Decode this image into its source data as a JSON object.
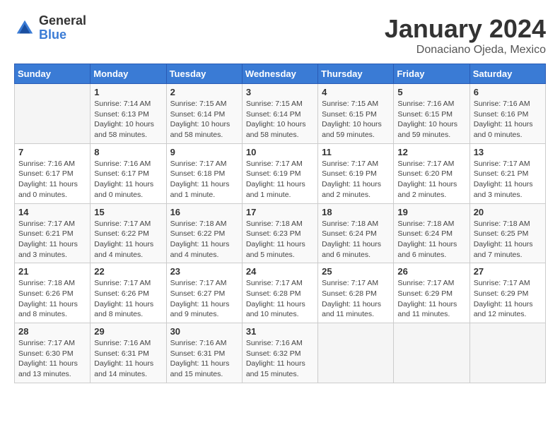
{
  "logo": {
    "general": "General",
    "blue": "Blue"
  },
  "title": {
    "month": "January 2024",
    "location": "Donaciano Ojeda, Mexico"
  },
  "weekdays": [
    "Sunday",
    "Monday",
    "Tuesday",
    "Wednesday",
    "Thursday",
    "Friday",
    "Saturday"
  ],
  "weeks": [
    [
      {
        "day": "",
        "info": ""
      },
      {
        "day": "1",
        "info": "Sunrise: 7:14 AM\nSunset: 6:13 PM\nDaylight: 10 hours\nand 58 minutes."
      },
      {
        "day": "2",
        "info": "Sunrise: 7:15 AM\nSunset: 6:14 PM\nDaylight: 10 hours\nand 58 minutes."
      },
      {
        "day": "3",
        "info": "Sunrise: 7:15 AM\nSunset: 6:14 PM\nDaylight: 10 hours\nand 58 minutes."
      },
      {
        "day": "4",
        "info": "Sunrise: 7:15 AM\nSunset: 6:15 PM\nDaylight: 10 hours\nand 59 minutes."
      },
      {
        "day": "5",
        "info": "Sunrise: 7:16 AM\nSunset: 6:15 PM\nDaylight: 10 hours\nand 59 minutes."
      },
      {
        "day": "6",
        "info": "Sunrise: 7:16 AM\nSunset: 6:16 PM\nDaylight: 11 hours\nand 0 minutes."
      }
    ],
    [
      {
        "day": "7",
        "info": "Sunrise: 7:16 AM\nSunset: 6:17 PM\nDaylight: 11 hours\nand 0 minutes."
      },
      {
        "day": "8",
        "info": "Sunrise: 7:16 AM\nSunset: 6:17 PM\nDaylight: 11 hours\nand 0 minutes."
      },
      {
        "day": "9",
        "info": "Sunrise: 7:17 AM\nSunset: 6:18 PM\nDaylight: 11 hours\nand 1 minute."
      },
      {
        "day": "10",
        "info": "Sunrise: 7:17 AM\nSunset: 6:19 PM\nDaylight: 11 hours\nand 1 minute."
      },
      {
        "day": "11",
        "info": "Sunrise: 7:17 AM\nSunset: 6:19 PM\nDaylight: 11 hours\nand 2 minutes."
      },
      {
        "day": "12",
        "info": "Sunrise: 7:17 AM\nSunset: 6:20 PM\nDaylight: 11 hours\nand 2 minutes."
      },
      {
        "day": "13",
        "info": "Sunrise: 7:17 AM\nSunset: 6:21 PM\nDaylight: 11 hours\nand 3 minutes."
      }
    ],
    [
      {
        "day": "14",
        "info": "Sunrise: 7:17 AM\nSunset: 6:21 PM\nDaylight: 11 hours\nand 3 minutes."
      },
      {
        "day": "15",
        "info": "Sunrise: 7:17 AM\nSunset: 6:22 PM\nDaylight: 11 hours\nand 4 minutes."
      },
      {
        "day": "16",
        "info": "Sunrise: 7:18 AM\nSunset: 6:22 PM\nDaylight: 11 hours\nand 4 minutes."
      },
      {
        "day": "17",
        "info": "Sunrise: 7:18 AM\nSunset: 6:23 PM\nDaylight: 11 hours\nand 5 minutes."
      },
      {
        "day": "18",
        "info": "Sunrise: 7:18 AM\nSunset: 6:24 PM\nDaylight: 11 hours\nand 6 minutes."
      },
      {
        "day": "19",
        "info": "Sunrise: 7:18 AM\nSunset: 6:24 PM\nDaylight: 11 hours\nand 6 minutes."
      },
      {
        "day": "20",
        "info": "Sunrise: 7:18 AM\nSunset: 6:25 PM\nDaylight: 11 hours\nand 7 minutes."
      }
    ],
    [
      {
        "day": "21",
        "info": "Sunrise: 7:18 AM\nSunset: 6:26 PM\nDaylight: 11 hours\nand 8 minutes."
      },
      {
        "day": "22",
        "info": "Sunrise: 7:17 AM\nSunset: 6:26 PM\nDaylight: 11 hours\nand 8 minutes."
      },
      {
        "day": "23",
        "info": "Sunrise: 7:17 AM\nSunset: 6:27 PM\nDaylight: 11 hours\nand 9 minutes."
      },
      {
        "day": "24",
        "info": "Sunrise: 7:17 AM\nSunset: 6:28 PM\nDaylight: 11 hours\nand 10 minutes."
      },
      {
        "day": "25",
        "info": "Sunrise: 7:17 AM\nSunset: 6:28 PM\nDaylight: 11 hours\nand 11 minutes."
      },
      {
        "day": "26",
        "info": "Sunrise: 7:17 AM\nSunset: 6:29 PM\nDaylight: 11 hours\nand 11 minutes."
      },
      {
        "day": "27",
        "info": "Sunrise: 7:17 AM\nSunset: 6:29 PM\nDaylight: 11 hours\nand 12 minutes."
      }
    ],
    [
      {
        "day": "28",
        "info": "Sunrise: 7:17 AM\nSunset: 6:30 PM\nDaylight: 11 hours\nand 13 minutes."
      },
      {
        "day": "29",
        "info": "Sunrise: 7:16 AM\nSunset: 6:31 PM\nDaylight: 11 hours\nand 14 minutes."
      },
      {
        "day": "30",
        "info": "Sunrise: 7:16 AM\nSunset: 6:31 PM\nDaylight: 11 hours\nand 15 minutes."
      },
      {
        "day": "31",
        "info": "Sunrise: 7:16 AM\nSunset: 6:32 PM\nDaylight: 11 hours\nand 15 minutes."
      },
      {
        "day": "",
        "info": ""
      },
      {
        "day": "",
        "info": ""
      },
      {
        "day": "",
        "info": ""
      }
    ]
  ]
}
